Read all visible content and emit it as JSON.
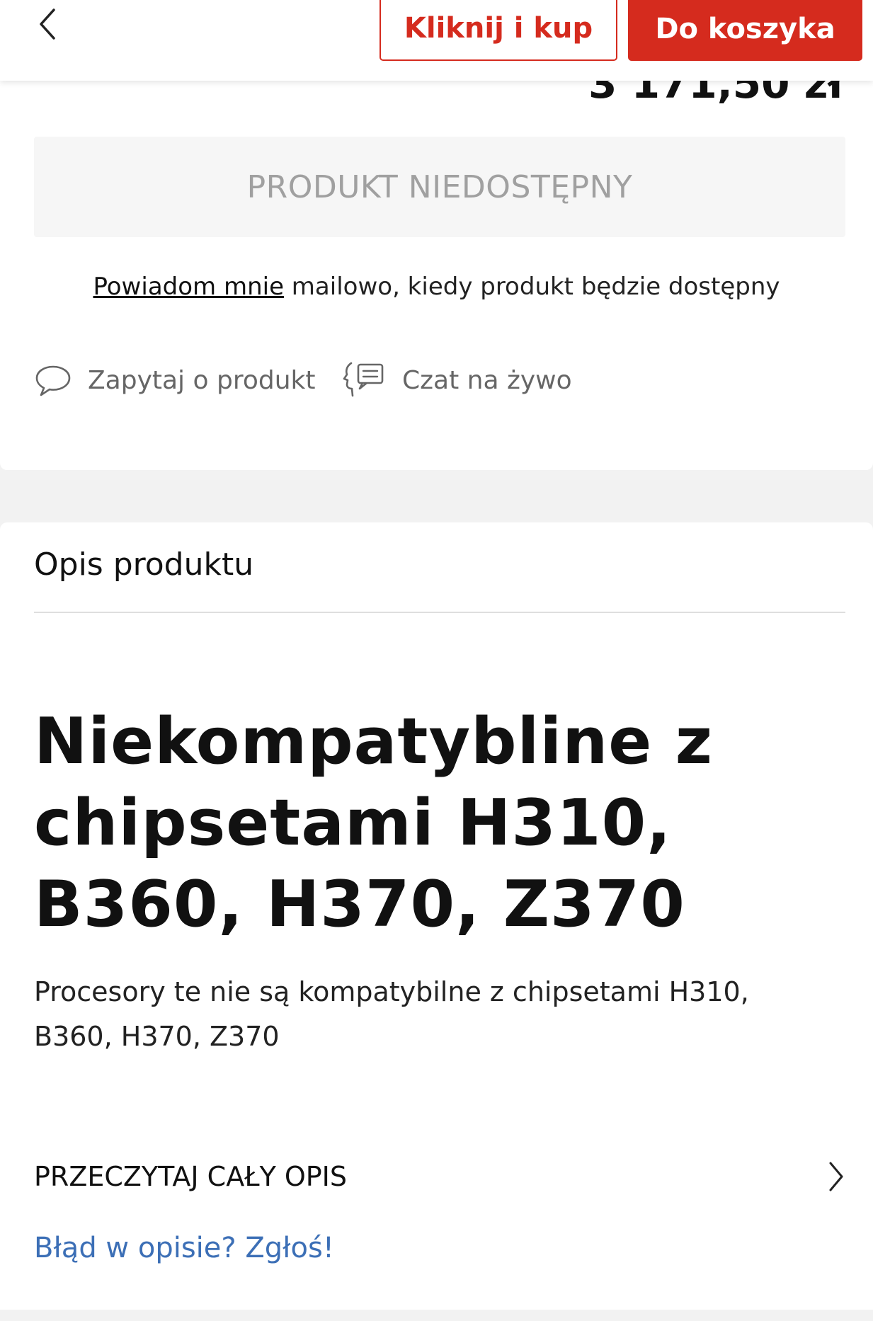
{
  "topbar": {
    "buy_now_label": "Kliknij i kup",
    "cart_label": "Do koszyka"
  },
  "product": {
    "price": "3 171,50 zł",
    "unavailable_label": "PRODUKT NIEDOSTĘPNY"
  },
  "notify": {
    "link_text": "Powiadom mnie",
    "rest_text": " mailowo, kiedy produkt będzie dostępny"
  },
  "actions": [
    {
      "label": "Zapytaj o produkt",
      "icon": "speech-bubble-icon"
    },
    {
      "label": "Czat na żywo",
      "icon": "chat-agent-icon"
    }
  ],
  "description": {
    "section_title": "Opis produktu",
    "headline": "Niekompatybline z chipsetami  H310, B360, H370, Z370",
    "paragraph": "Procesory te nie są kompatybilne z chipsetami H310, B360, H370, Z370",
    "read_more": "PRZECZYTAJ CAŁY OPIS",
    "report_error": "Błąd w opisie? Zgłoś!"
  },
  "colors": {
    "accent": "#d52b1e",
    "link": "#3c6fb6",
    "muted": "#a0a0a0"
  }
}
